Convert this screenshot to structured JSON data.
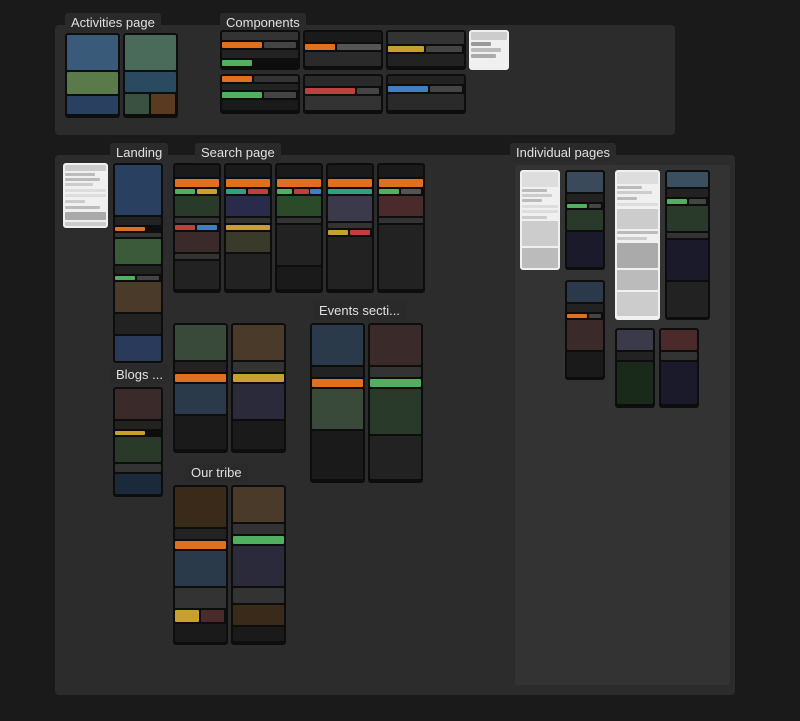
{
  "labels": {
    "activities": "Activities page",
    "components": "Components",
    "landing": "Landing",
    "search_page": "Search page",
    "individual_pages": "Individual pages",
    "blogs": "Blogs ...",
    "events_section": "Events secti...",
    "our_tribe": "Our tribe"
  },
  "colors": {
    "bg": "#1a1a1a",
    "section_bg": "#2c2c2c",
    "frame_dark": "#111111",
    "frame_med": "#1c1c1c",
    "label_bg": "#2a2a2a",
    "accent_orange": "#e07020",
    "accent_green": "#50b060",
    "accent_yellow": "#c8a030",
    "accent_red": "#c04040",
    "accent_blue": "#4080c0",
    "accent_teal": "#30a080",
    "text_light": "#e0e0e0",
    "white": "#f0f0f0"
  }
}
